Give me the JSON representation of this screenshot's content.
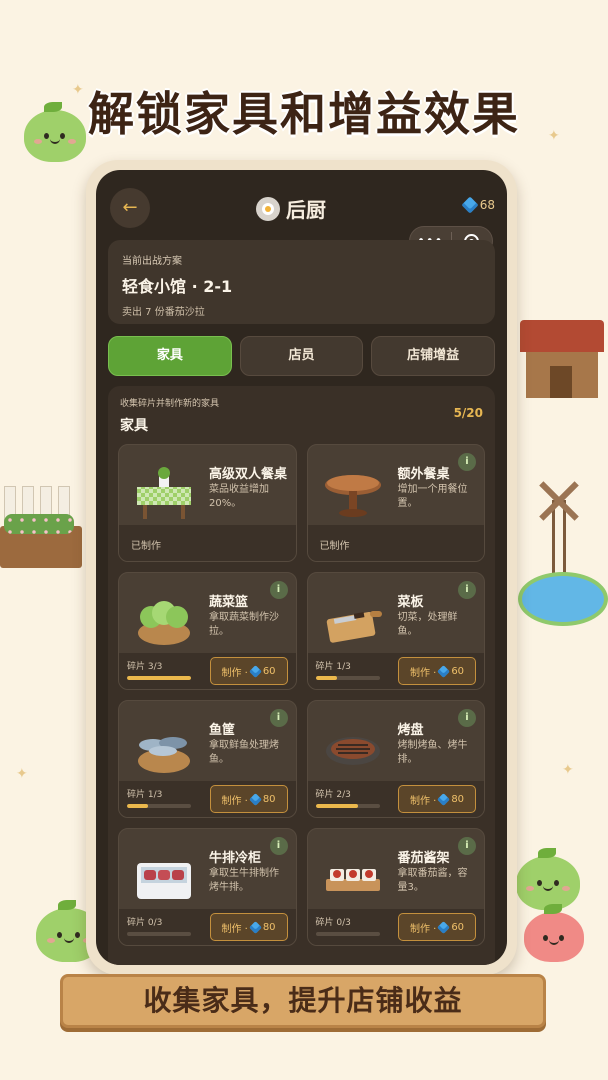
{
  "banner": {
    "title": "解锁家具和增益效果",
    "footer": "收集家具，提升店铺收益"
  },
  "header": {
    "back_icon": "arrow-left-icon",
    "title": "后厨",
    "gems": "68",
    "more": "•••"
  },
  "plan": {
    "label": "当前出战方案",
    "name": "轻食小馆 · 2-1",
    "desc": "卖出 7 份番茄沙拉"
  },
  "tabs": [
    "家具",
    "店员",
    "店铺增益"
  ],
  "panel": {
    "subtitle": "收集碎片并制作新的家具",
    "title": "家具",
    "count": "5/20"
  },
  "items": [
    {
      "name": "高级双人餐桌",
      "desc": "菜品收益增加20%。",
      "status": "已制作"
    },
    {
      "name": "额外餐桌",
      "desc": "增加一个用餐位置。",
      "status": "已制作"
    },
    {
      "name": "蔬菜篮",
      "desc": "拿取蔬菜制作沙拉。",
      "fragments": "碎片 3/3",
      "progress": 1.0,
      "craft_label": "制作 ·",
      "cost": "60"
    },
    {
      "name": "菜板",
      "desc": "切菜，处理鲜鱼。",
      "fragments": "碎片 1/3",
      "progress": 0.33,
      "craft_label": "制作 ·",
      "cost": "60"
    },
    {
      "name": "鱼筐",
      "desc": "拿取鲜鱼处理烤鱼。",
      "fragments": "碎片 1/3",
      "progress": 0.33,
      "craft_label": "制作 ·",
      "cost": "80"
    },
    {
      "name": "烤盘",
      "desc": "烤制烤鱼、烤牛排。",
      "fragments": "碎片 2/3",
      "progress": 0.67,
      "craft_label": "制作 ·",
      "cost": "80"
    },
    {
      "name": "牛排冷柜",
      "desc": "拿取生牛排制作烤牛排。",
      "fragments": "碎片 0/3",
      "progress": 0,
      "craft_label": "制作 ·",
      "cost": "80"
    },
    {
      "name": "番茄酱架",
      "desc": "拿取番茄酱，容量3。",
      "fragments": "碎片 0/3",
      "progress": 0,
      "craft_label": "制作 ·",
      "cost": "60"
    }
  ],
  "colors": {
    "accent_green": "#5ea336",
    "gold": "#e6b652",
    "screen_bg": "#2f271f"
  }
}
